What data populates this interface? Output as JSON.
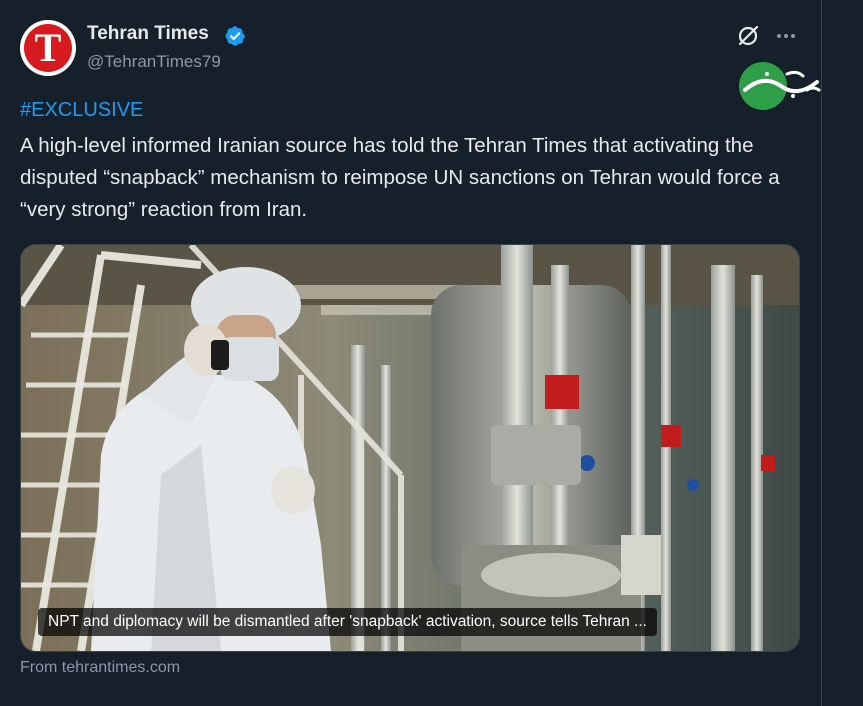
{
  "tweet": {
    "author": {
      "name": "Tehran Times",
      "handle": "@TehranTimes79",
      "verified": true,
      "avatar_letter": "T"
    },
    "hashtag": "#EXCLUSIVE",
    "text": "A high-level informed Iranian source has told the Tehran Times that activating the disputed “snapback” mechanism to reimpose UN sanctions on Tehran would force a “very strong” reaction from Iran.",
    "card": {
      "caption": "NPT and diplomacy will be dismantled after 'snapback' activation, source tells Tehran ...",
      "source": "From tehrantimes.com"
    }
  },
  "watermark": {
    "text": "خبر فوری"
  },
  "colors": {
    "background": "#15202b",
    "accent": "#1d9bf0",
    "text_primary": "#e7e9ea",
    "text_secondary": "#8b98a5",
    "border": "#38444d",
    "avatar_red": "#d71920",
    "watermark_green": "#2e9e48"
  },
  "icons": {
    "verified": "verified-badge-icon",
    "grok": "grok-icon",
    "more": "more-options-icon"
  }
}
